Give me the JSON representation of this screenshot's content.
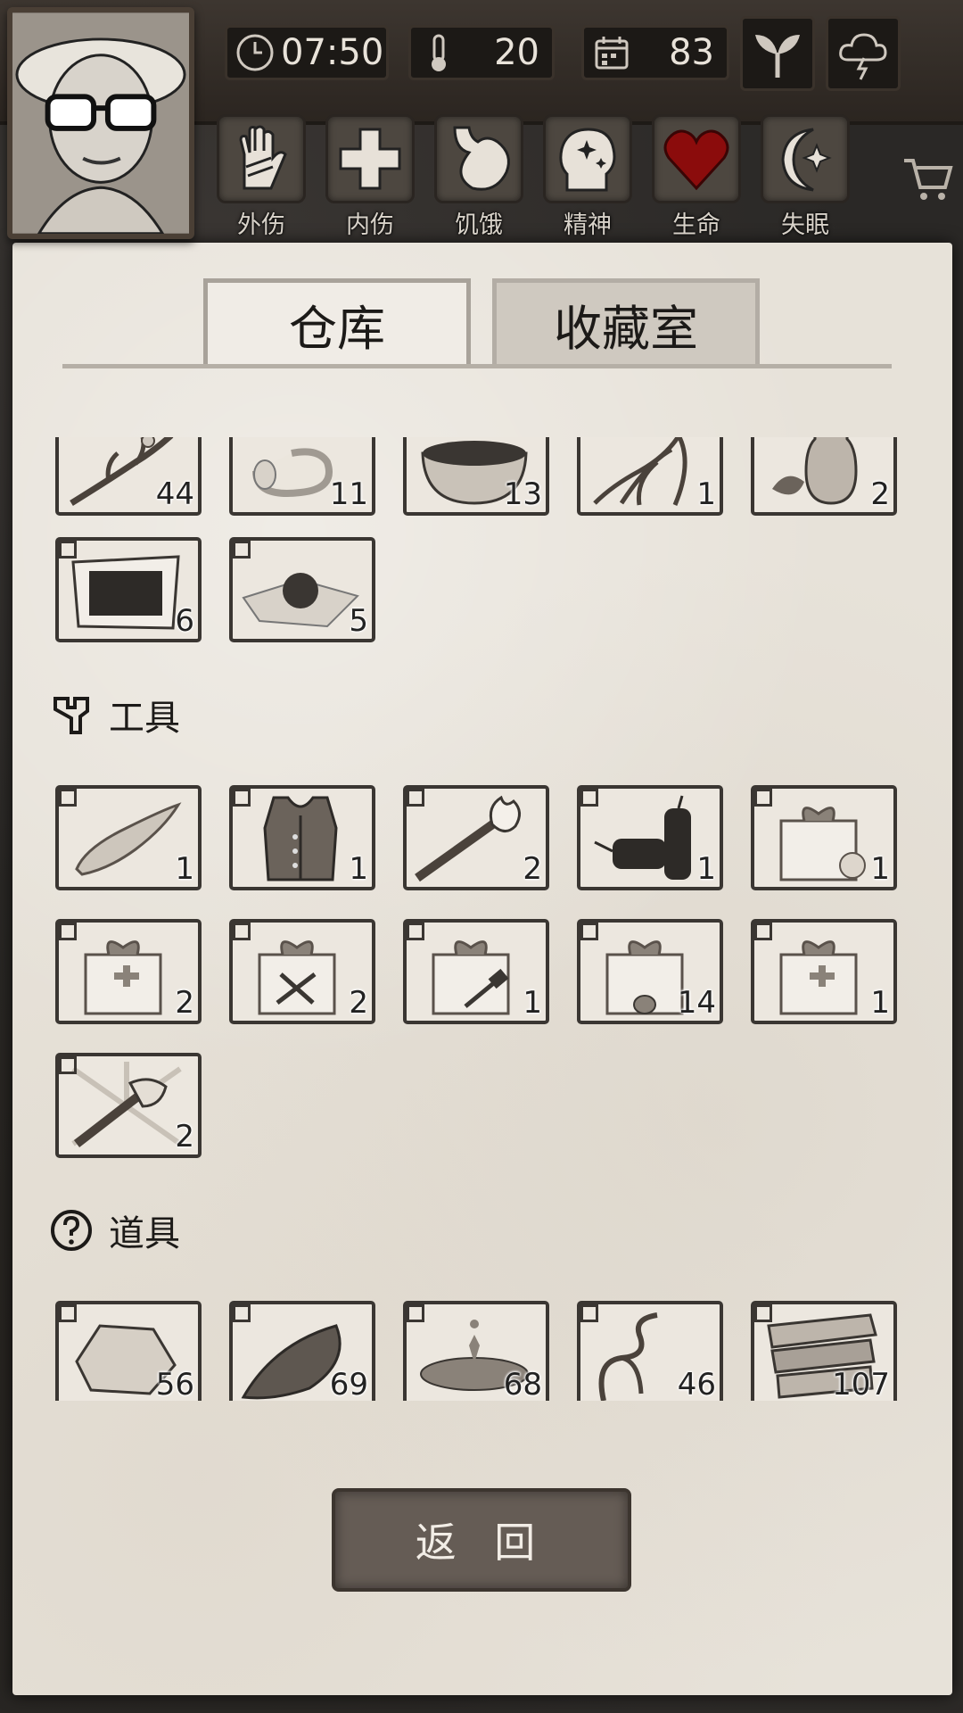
{
  "hud": {
    "time": "07:50",
    "temperature": "20",
    "day": "83",
    "plant_icon": "sprout-icon",
    "weather_icon": "thunderstorm-icon"
  },
  "statuses": [
    {
      "label": "外伤",
      "icon": "hand-icon"
    },
    {
      "label": "内伤",
      "icon": "cross-icon"
    },
    {
      "label": "饥饿",
      "icon": "stomach-icon"
    },
    {
      "label": "精神",
      "icon": "head-sparkle-icon"
    },
    {
      "label": "生命",
      "icon": "heart-icon",
      "color": "#8b0c0c"
    },
    {
      "label": "失眠",
      "icon": "moon-star-icon"
    }
  ],
  "tabs": {
    "warehouse": "仓库",
    "collection": "收藏室"
  },
  "inventory": {
    "misc_row1": [
      {
        "name": "branch",
        "count": "44"
      },
      {
        "name": "scroll",
        "count": "11"
      },
      {
        "name": "bowl",
        "count": "13"
      },
      {
        "name": "roots",
        "count": "1"
      },
      {
        "name": "herb-jar",
        "count": "2"
      }
    ],
    "misc_row2": [
      {
        "name": "cloth-patch",
        "count": "6"
      },
      {
        "name": "pill",
        "count": "5"
      }
    ],
    "tools_title": "工具",
    "tools": [
      {
        "name": "stone-blade",
        "count": "1"
      },
      {
        "name": "vest",
        "count": "1"
      },
      {
        "name": "torch",
        "count": "2"
      },
      {
        "name": "firecrackers",
        "count": "1"
      },
      {
        "name": "food-gift-box",
        "count": "1"
      },
      {
        "name": "medical-gift-box",
        "count": "2"
      },
      {
        "name": "tool-gift-box",
        "count": "2"
      },
      {
        "name": "hammer-gift-box",
        "count": "1"
      },
      {
        "name": "wood-gift-box",
        "count": "14"
      },
      {
        "name": "medical-gift-box-2",
        "count": "1"
      },
      {
        "name": "stone-axe",
        "count": "2"
      }
    ],
    "props_title": "道具",
    "props": [
      {
        "name": "stone",
        "count": "56"
      },
      {
        "name": "leaf",
        "count": "69"
      },
      {
        "name": "water",
        "count": "68"
      },
      {
        "name": "vine",
        "count": "46"
      },
      {
        "name": "planks",
        "count": "107"
      }
    ]
  },
  "back_button": "返 回"
}
